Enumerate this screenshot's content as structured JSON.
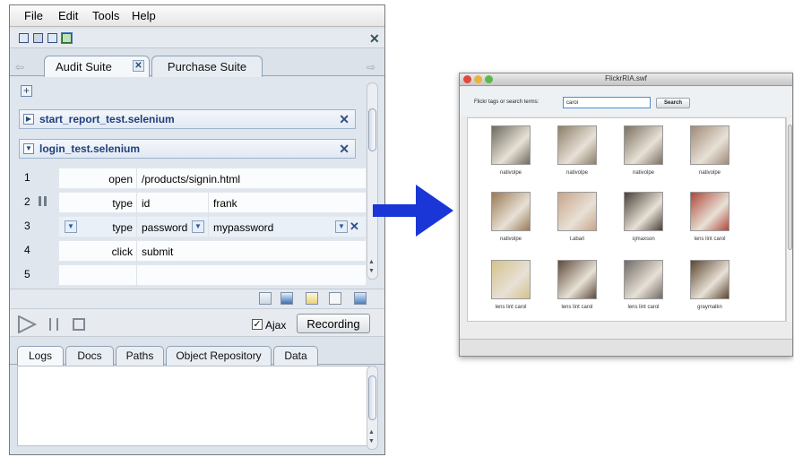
{
  "ide": {
    "menu": [
      "File",
      "Edit",
      "Tools",
      "Help"
    ],
    "tabs": [
      {
        "label": "Audit Suite",
        "active": true
      },
      {
        "label": "Purchase Suite",
        "active": false
      }
    ],
    "suites": [
      {
        "name": "start_report_test.selenium",
        "expanded": false
      },
      {
        "name": "login_test.selenium",
        "expanded": true
      }
    ],
    "commands": [
      {
        "num": "1",
        "command": "open",
        "target": "/products/signin.html",
        "value": ""
      },
      {
        "num": "2",
        "command": "type",
        "target": "id",
        "value": "frank"
      },
      {
        "num": "3",
        "command": "type",
        "target": "password",
        "value": "mypassword"
      },
      {
        "num": "4",
        "command": "click",
        "target": "submit",
        "value": ""
      },
      {
        "num": "5",
        "command": "",
        "target": "",
        "value": ""
      }
    ],
    "ajax_label": "Ajax",
    "ajax_checked": true,
    "recording_label": "Recording",
    "bottom_tabs": [
      "Logs",
      "Docs",
      "Paths",
      "Object Repository",
      "Data"
    ]
  },
  "flickr": {
    "title": "FlickrRIA.swf",
    "search_label": "Flickr tags or search terms:",
    "search_value": "carol",
    "search_button": "Search",
    "photos": [
      {
        "caption": "nativolpe",
        "color": "#6d6a5f"
      },
      {
        "caption": "nativolpe",
        "color": "#8c7e6a"
      },
      {
        "caption": "nativolpe",
        "color": "#7a7060"
      },
      {
        "caption": "nativolpe",
        "color": "#a08a78"
      },
      {
        "caption": "nativolpe",
        "color": "#9a7a55"
      },
      {
        "caption": "t.abari",
        "color": "#c7a58a"
      },
      {
        "caption": "sjmaxson",
        "color": "#4a4038"
      },
      {
        "caption": "lens lint carol",
        "color": "#b0463a"
      },
      {
        "caption": "lens lint carol",
        "color": "#d4c28c"
      },
      {
        "caption": "lens lint carol",
        "color": "#5e4a3a"
      },
      {
        "caption": "lens lint carol",
        "color": "#6f6a66"
      },
      {
        "caption": "graymalkn",
        "color": "#5a4630"
      }
    ]
  },
  "colors": {
    "arrow": "#1a36d6",
    "accent": "#1f3f7d"
  }
}
